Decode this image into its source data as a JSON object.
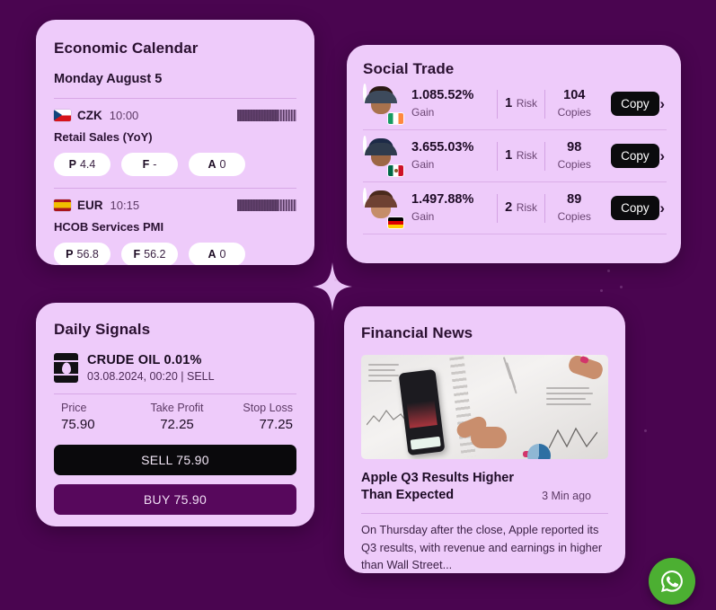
{
  "theme": {
    "background": "#4a0550",
    "card_background": "#eecbfa",
    "accent_dark": "#0b0b0d",
    "accent_buy": "#57085c",
    "whatsapp_green": "#4caf32"
  },
  "economic_calendar": {
    "title": "Economic Calendar",
    "date": "Monday August 5",
    "events": [
      {
        "flag": "cz-flag-icon",
        "currency": "CZK",
        "time": "10:00",
        "event": "Retail Sales (YoY)",
        "pills": [
          {
            "key": "P",
            "value": "4.4"
          },
          {
            "key": "F",
            "value": "-"
          },
          {
            "key": "A",
            "value": "0"
          }
        ]
      },
      {
        "flag": "es-flag-icon",
        "currency": "EUR",
        "time": "10:15",
        "event": "HCOB Services PMI",
        "pills": [
          {
            "key": "P",
            "value": "56.8"
          },
          {
            "key": "F",
            "value": "56.2"
          },
          {
            "key": "A",
            "value": "0"
          }
        ]
      }
    ]
  },
  "social_trade": {
    "title": "Social Trade",
    "copy_label": "Copy",
    "labels": {
      "gain": "Gain",
      "risk": "Risk",
      "copies": "Copies"
    },
    "traders": [
      {
        "gain": "1.085.52%",
        "risk": "1",
        "copies": "104",
        "flag": "ie-flag-icon"
      },
      {
        "gain": "3.655.03%",
        "risk": "1",
        "copies": "98",
        "flag": "mx-flag-icon"
      },
      {
        "gain": "1.497.88%",
        "risk": "2",
        "copies": "89",
        "flag": "de-flag-icon"
      }
    ]
  },
  "daily_signals": {
    "title": "Daily Signals",
    "symbol": "CRUDE OIL 0.01%",
    "meta": "03.08.2024, 00:20  | SELL",
    "stats": [
      {
        "label": "Price",
        "value": "75.90"
      },
      {
        "label": "Take Profit",
        "value": "72.25"
      },
      {
        "label": "Stop Loss",
        "value": "77.25"
      }
    ],
    "sell_button": "SELL 75.90",
    "buy_button": "BUY 75.90"
  },
  "financial_news": {
    "title": "Financial News",
    "headline": "Apple Q3 Results Higher Than Expected",
    "time_ago": "3 Min ago",
    "body": "On Thursday after the close, Apple reported its Q3 results, with revenue and earnings in higher than Wall Street..."
  }
}
